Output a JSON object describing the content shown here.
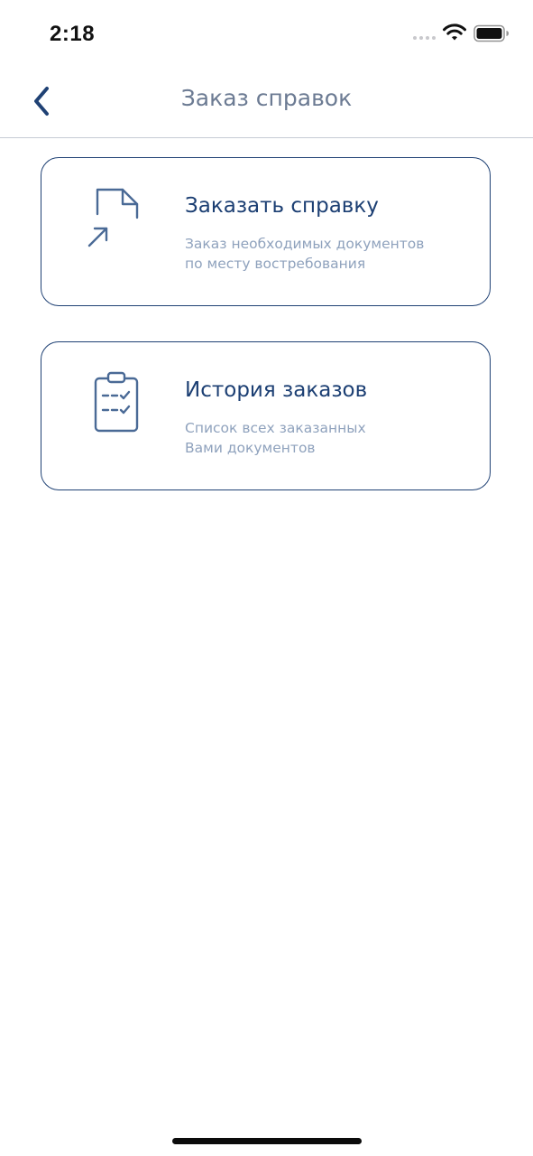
{
  "status_bar": {
    "time": "2:18",
    "icons": [
      "signal-dots-icon",
      "wifi-icon",
      "battery-icon"
    ]
  },
  "nav": {
    "back_icon": "chevron-left-icon",
    "title": "Заказ справок"
  },
  "cards": [
    {
      "icon": "document-arrow-icon",
      "title": "Заказать справку",
      "description_lines": [
        "Заказ необходимых документов",
        "по месту востребования"
      ]
    },
    {
      "icon": "clipboard-checklist-icon",
      "title": "История заказов",
      "description_lines": [
        "Список всех заказанных",
        "Вами документов"
      ]
    }
  ],
  "colors": {
    "accent": "#1c3f73",
    "border": "#1f4174",
    "nav_title": "#6c7b93",
    "description": "#8fa2bd",
    "icon": "#4a6a96",
    "divider": "#c5cbd4"
  }
}
